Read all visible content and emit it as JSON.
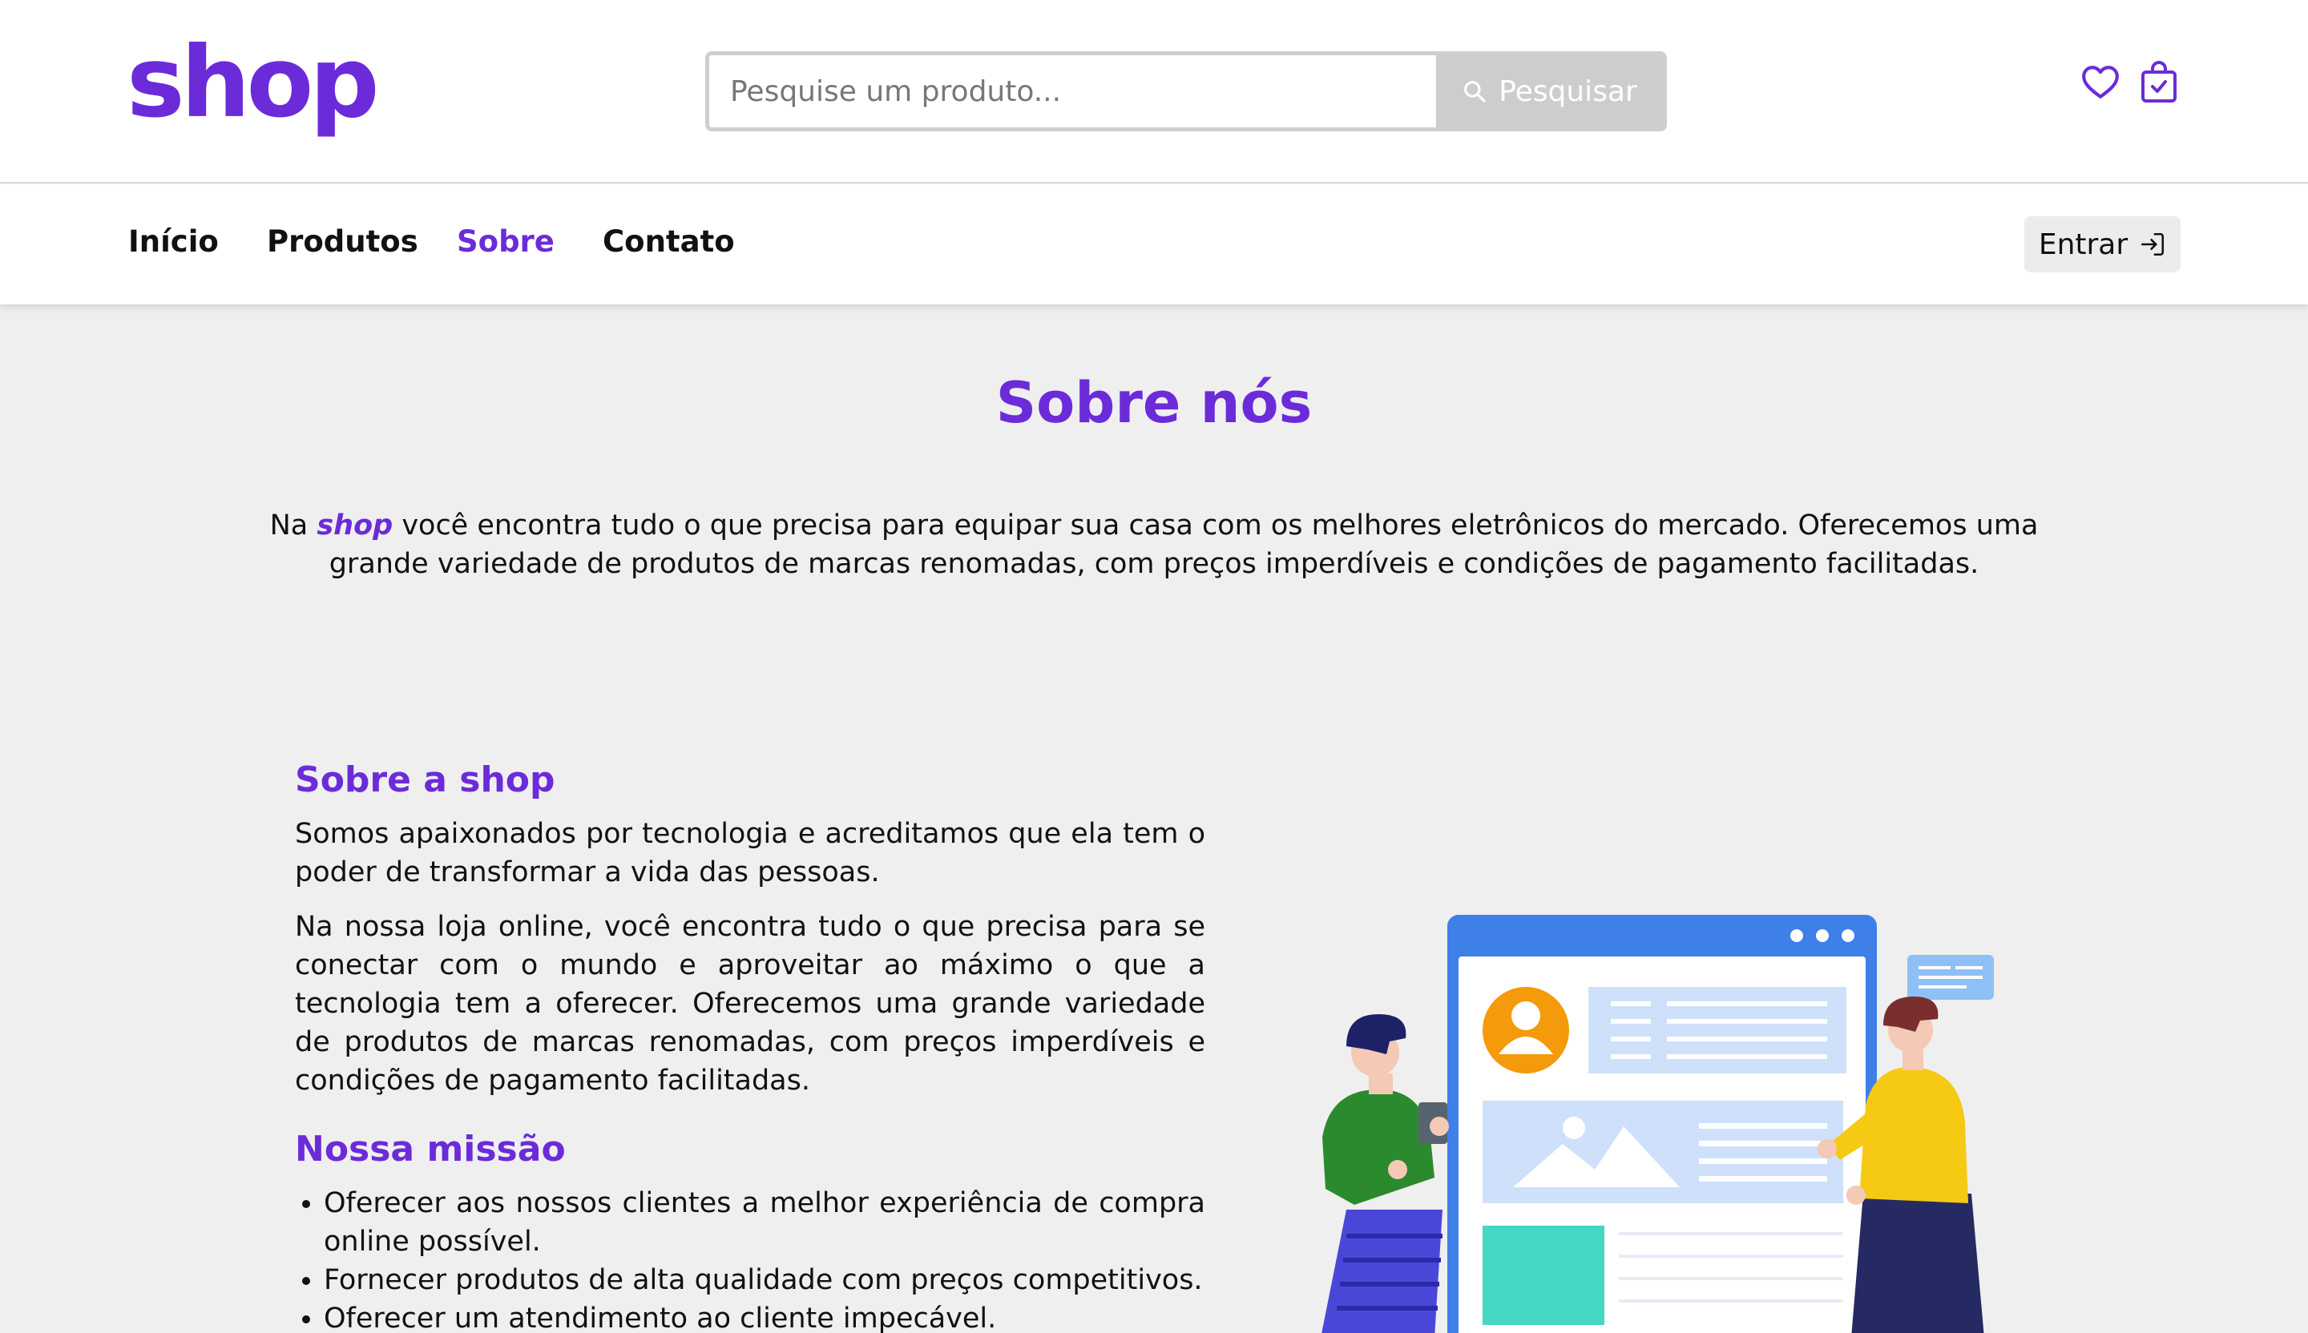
{
  "header": {
    "logo": "shop",
    "search": {
      "placeholder": "Pesquise um produto...",
      "button_label": "Pesquisar"
    }
  },
  "nav": {
    "items": [
      {
        "label": "Início",
        "active": false
      },
      {
        "label": "Produtos",
        "active": false
      },
      {
        "label": "Sobre",
        "active": true
      },
      {
        "label": "Contato",
        "active": false
      }
    ],
    "login_label": "Entrar"
  },
  "page": {
    "title": "Sobre nós",
    "intro_prefix": "Na ",
    "intro_brand": "shop",
    "intro_text": " você encontra tudo o que precisa para equipar sua casa com os melhores eletrônicos do mercado. Oferecemos uma grande variedade de produtos de marcas renomadas, com preços imperdíveis e condições de pagamento facilitadas."
  },
  "about": {
    "heading": "Sobre a shop",
    "paragraphs": [
      "Somos apaixonados por tecnologia e acreditamos que ela tem o poder de transformar a vida das pessoas.",
      "Na nossa loja online, você encontra tudo o que precisa para se conectar com o mundo e aproveitar ao máximo o que a tecnologia tem a oferecer. Oferecemos uma grande variedade de produtos de marcas renomadas, com preços imperdíveis e condições de pagamento facilitadas."
    ],
    "mission_heading": "Nossa missão",
    "mission_items": [
      "Oferecer aos nossos clientes a melhor experiência de compra online possível.",
      "Fornecer produtos de alta qualidade com preços competitivos.",
      "Oferecer um atendimento ao cliente impecável."
    ]
  },
  "colors": {
    "brand": "#6c2bd9",
    "search_button": "#cdcdcd",
    "illustration_blue": "#3f7fe8",
    "illustration_orange": "#f59a0b",
    "illustration_teal": "#44d7c2",
    "illustration_yellow": "#f6c915",
    "illustration_green": "#2b8a2e"
  },
  "icons": [
    "search-icon",
    "heart-icon",
    "shopping-bag-icon",
    "login-icon"
  ]
}
